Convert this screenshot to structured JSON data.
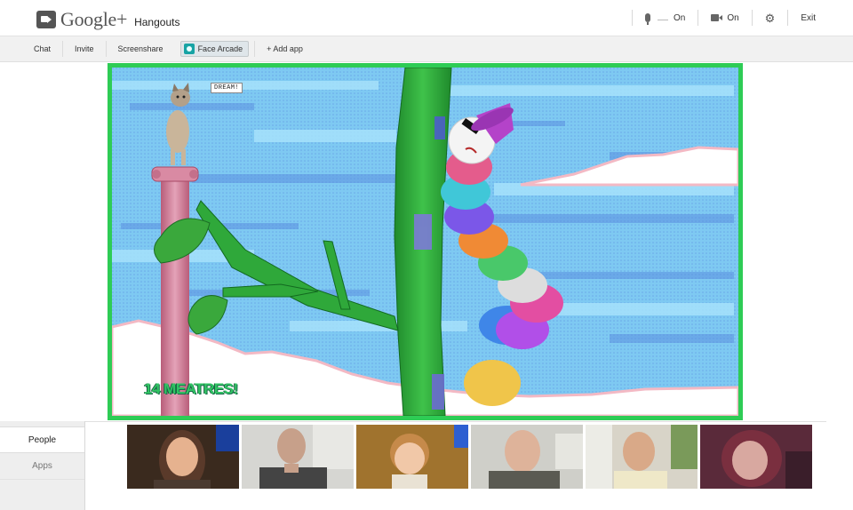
{
  "header": {
    "brand": "Google+",
    "product": "Hangouts",
    "mic_label": "On",
    "camera_label": "On",
    "exit_label": "Exit",
    "icons": [
      "hangouts-logo-icon",
      "microphone-icon",
      "camera-icon",
      "gear-icon"
    ]
  },
  "toolbar": {
    "items": [
      "Chat",
      "Invite",
      "Screenshare",
      "Face Arcade",
      "+ Add app"
    ],
    "active": "Face Arcade"
  },
  "stage": {
    "speech_bubble": "DREAM!",
    "score_text": "14 MEATRES!"
  },
  "dock": {
    "tabs": [
      "People",
      "Apps"
    ],
    "selected_tab": "People",
    "participant_count": 6
  },
  "colors": {
    "stage_border": "#2ecc55",
    "sky": "#7ec9f2",
    "score": "#30c463"
  }
}
